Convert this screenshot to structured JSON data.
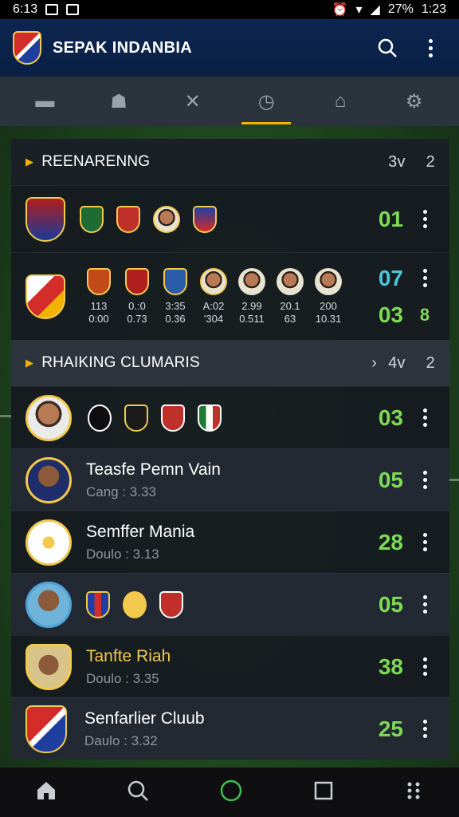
{
  "status": {
    "time": "6:13",
    "battery": "27%",
    "clock": "1:23"
  },
  "app": {
    "title": "SEPAK INDANBIA",
    "search_icon": "search-icon",
    "menu_icon": "more-vert-icon"
  },
  "tabs": [
    {
      "icon": "chat-icon"
    },
    {
      "icon": "players-icon"
    },
    {
      "icon": "close-icon"
    },
    {
      "icon": "clock-icon",
      "active": true
    },
    {
      "icon": "stadium-icon"
    },
    {
      "icon": "settings-icon"
    }
  ],
  "section1": {
    "title": "REENARENNG",
    "meta1": "3v",
    "meta2": "2",
    "row1": {
      "score": "01"
    },
    "row2": {
      "score_top": "07",
      "score_bottom": "03",
      "extra": "8",
      "stats": [
        {
          "a": "113",
          "b": "0:00"
        },
        {
          "a": "0.:0",
          "b": "0.73"
        },
        {
          "a": "3:35",
          "b": "0.36"
        },
        {
          "a": "A:02",
          "b": "'304"
        },
        {
          "a": "2.99",
          "b": "0.511"
        },
        {
          "a": "20.1",
          "b": "63"
        },
        {
          "a": "200",
          "b": "10.31"
        }
      ]
    }
  },
  "section2": {
    "title": "RHAIKING CLUMARIS",
    "meta1": "4v",
    "meta2": "2",
    "rows": [
      {
        "name": "",
        "sub": "",
        "score": "03"
      },
      {
        "name": "Teasfe Pemn Vain",
        "sub": "Cang : 3.33",
        "score": "05"
      },
      {
        "name": "Semffer Mania",
        "sub": "Doulo : 3.13",
        "score": "28"
      },
      {
        "name": "",
        "sub": "",
        "score": "05"
      },
      {
        "name": "Tanfte Riah",
        "sub": "Doulo : 3.35",
        "score": "38"
      },
      {
        "name": "Senfarlier Cluub",
        "sub": "Daulo : 3.32",
        "score": "25"
      }
    ]
  },
  "nav": [
    "home-icon",
    "search-icon",
    "circle-icon",
    "square-icon",
    "grid-icon"
  ],
  "colors": {
    "accent": "#f2b300",
    "score_green": "#7ed957",
    "score_blue": "#4fc3d9",
    "appbar": "#0a1f44"
  }
}
